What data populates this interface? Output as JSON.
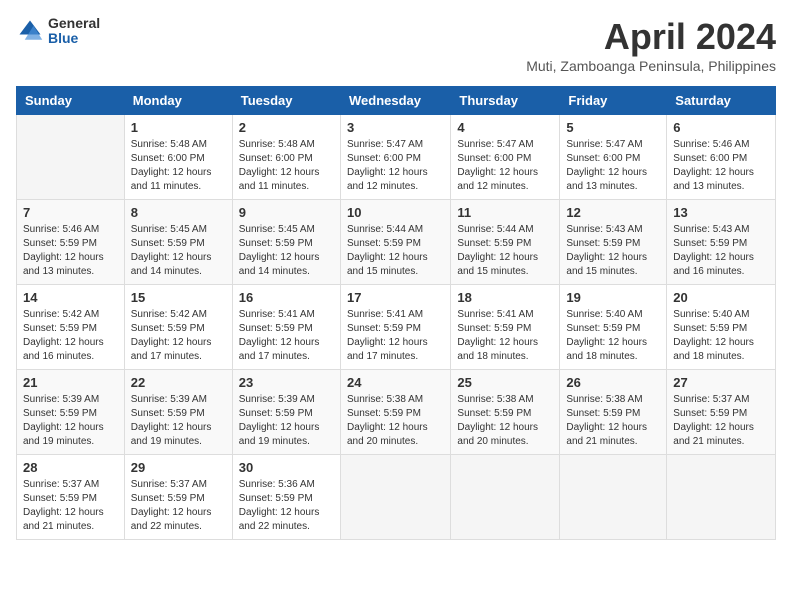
{
  "logo": {
    "general": "General",
    "blue": "Blue"
  },
  "title": "April 2024",
  "location": "Muti, Zamboanga Peninsula, Philippines",
  "days": [
    "Sunday",
    "Monday",
    "Tuesday",
    "Wednesday",
    "Thursday",
    "Friday",
    "Saturday"
  ],
  "weeks": [
    [
      {
        "num": "",
        "sunrise": "",
        "sunset": "",
        "daylight": ""
      },
      {
        "num": "1",
        "sunrise": "Sunrise: 5:48 AM",
        "sunset": "Sunset: 6:00 PM",
        "daylight": "Daylight: 12 hours and 11 minutes."
      },
      {
        "num": "2",
        "sunrise": "Sunrise: 5:48 AM",
        "sunset": "Sunset: 6:00 PM",
        "daylight": "Daylight: 12 hours and 11 minutes."
      },
      {
        "num": "3",
        "sunrise": "Sunrise: 5:47 AM",
        "sunset": "Sunset: 6:00 PM",
        "daylight": "Daylight: 12 hours and 12 minutes."
      },
      {
        "num": "4",
        "sunrise": "Sunrise: 5:47 AM",
        "sunset": "Sunset: 6:00 PM",
        "daylight": "Daylight: 12 hours and 12 minutes."
      },
      {
        "num": "5",
        "sunrise": "Sunrise: 5:47 AM",
        "sunset": "Sunset: 6:00 PM",
        "daylight": "Daylight: 12 hours and 13 minutes."
      },
      {
        "num": "6",
        "sunrise": "Sunrise: 5:46 AM",
        "sunset": "Sunset: 6:00 PM",
        "daylight": "Daylight: 12 hours and 13 minutes."
      }
    ],
    [
      {
        "num": "7",
        "sunrise": "Sunrise: 5:46 AM",
        "sunset": "Sunset: 5:59 PM",
        "daylight": "Daylight: 12 hours and 13 minutes."
      },
      {
        "num": "8",
        "sunrise": "Sunrise: 5:45 AM",
        "sunset": "Sunset: 5:59 PM",
        "daylight": "Daylight: 12 hours and 14 minutes."
      },
      {
        "num": "9",
        "sunrise": "Sunrise: 5:45 AM",
        "sunset": "Sunset: 5:59 PM",
        "daylight": "Daylight: 12 hours and 14 minutes."
      },
      {
        "num": "10",
        "sunrise": "Sunrise: 5:44 AM",
        "sunset": "Sunset: 5:59 PM",
        "daylight": "Daylight: 12 hours and 15 minutes."
      },
      {
        "num": "11",
        "sunrise": "Sunrise: 5:44 AM",
        "sunset": "Sunset: 5:59 PM",
        "daylight": "Daylight: 12 hours and 15 minutes."
      },
      {
        "num": "12",
        "sunrise": "Sunrise: 5:43 AM",
        "sunset": "Sunset: 5:59 PM",
        "daylight": "Daylight: 12 hours and 15 minutes."
      },
      {
        "num": "13",
        "sunrise": "Sunrise: 5:43 AM",
        "sunset": "Sunset: 5:59 PM",
        "daylight": "Daylight: 12 hours and 16 minutes."
      }
    ],
    [
      {
        "num": "14",
        "sunrise": "Sunrise: 5:42 AM",
        "sunset": "Sunset: 5:59 PM",
        "daylight": "Daylight: 12 hours and 16 minutes."
      },
      {
        "num": "15",
        "sunrise": "Sunrise: 5:42 AM",
        "sunset": "Sunset: 5:59 PM",
        "daylight": "Daylight: 12 hours and 17 minutes."
      },
      {
        "num": "16",
        "sunrise": "Sunrise: 5:41 AM",
        "sunset": "Sunset: 5:59 PM",
        "daylight": "Daylight: 12 hours and 17 minutes."
      },
      {
        "num": "17",
        "sunrise": "Sunrise: 5:41 AM",
        "sunset": "Sunset: 5:59 PM",
        "daylight": "Daylight: 12 hours and 17 minutes."
      },
      {
        "num": "18",
        "sunrise": "Sunrise: 5:41 AM",
        "sunset": "Sunset: 5:59 PM",
        "daylight": "Daylight: 12 hours and 18 minutes."
      },
      {
        "num": "19",
        "sunrise": "Sunrise: 5:40 AM",
        "sunset": "Sunset: 5:59 PM",
        "daylight": "Daylight: 12 hours and 18 minutes."
      },
      {
        "num": "20",
        "sunrise": "Sunrise: 5:40 AM",
        "sunset": "Sunset: 5:59 PM",
        "daylight": "Daylight: 12 hours and 18 minutes."
      }
    ],
    [
      {
        "num": "21",
        "sunrise": "Sunrise: 5:39 AM",
        "sunset": "Sunset: 5:59 PM",
        "daylight": "Daylight: 12 hours and 19 minutes."
      },
      {
        "num": "22",
        "sunrise": "Sunrise: 5:39 AM",
        "sunset": "Sunset: 5:59 PM",
        "daylight": "Daylight: 12 hours and 19 minutes."
      },
      {
        "num": "23",
        "sunrise": "Sunrise: 5:39 AM",
        "sunset": "Sunset: 5:59 PM",
        "daylight": "Daylight: 12 hours and 19 minutes."
      },
      {
        "num": "24",
        "sunrise": "Sunrise: 5:38 AM",
        "sunset": "Sunset: 5:59 PM",
        "daylight": "Daylight: 12 hours and 20 minutes."
      },
      {
        "num": "25",
        "sunrise": "Sunrise: 5:38 AM",
        "sunset": "Sunset: 5:59 PM",
        "daylight": "Daylight: 12 hours and 20 minutes."
      },
      {
        "num": "26",
        "sunrise": "Sunrise: 5:38 AM",
        "sunset": "Sunset: 5:59 PM",
        "daylight": "Daylight: 12 hours and 21 minutes."
      },
      {
        "num": "27",
        "sunrise": "Sunrise: 5:37 AM",
        "sunset": "Sunset: 5:59 PM",
        "daylight": "Daylight: 12 hours and 21 minutes."
      }
    ],
    [
      {
        "num": "28",
        "sunrise": "Sunrise: 5:37 AM",
        "sunset": "Sunset: 5:59 PM",
        "daylight": "Daylight: 12 hours and 21 minutes."
      },
      {
        "num": "29",
        "sunrise": "Sunrise: 5:37 AM",
        "sunset": "Sunset: 5:59 PM",
        "daylight": "Daylight: 12 hours and 22 minutes."
      },
      {
        "num": "30",
        "sunrise": "Sunrise: 5:36 AM",
        "sunset": "Sunset: 5:59 PM",
        "daylight": "Daylight: 12 hours and 22 minutes."
      },
      {
        "num": "",
        "sunrise": "",
        "sunset": "",
        "daylight": ""
      },
      {
        "num": "",
        "sunrise": "",
        "sunset": "",
        "daylight": ""
      },
      {
        "num": "",
        "sunrise": "",
        "sunset": "",
        "daylight": ""
      },
      {
        "num": "",
        "sunrise": "",
        "sunset": "",
        "daylight": ""
      }
    ]
  ]
}
